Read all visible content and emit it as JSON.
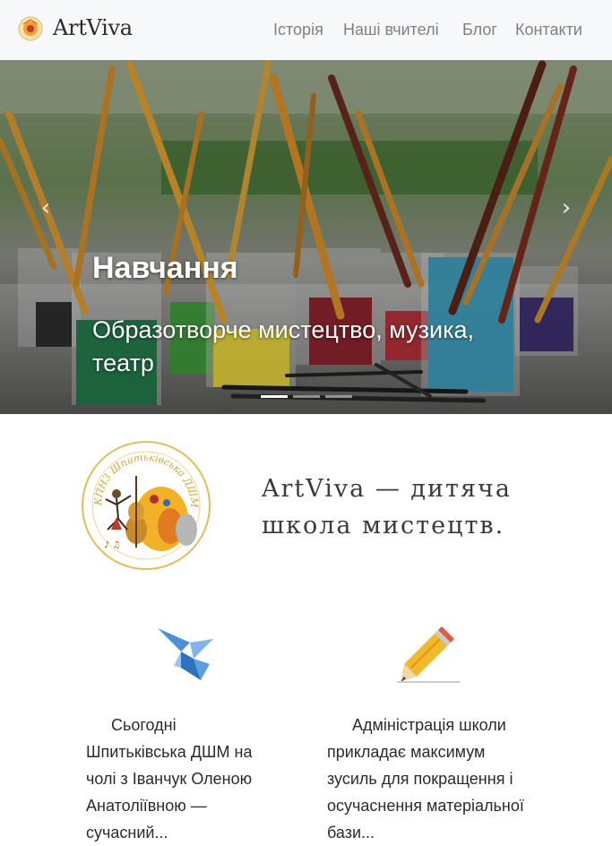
{
  "brand": {
    "name": "ArtViva",
    "logo_icon": "sun-flower-logo-icon"
  },
  "nav": {
    "items": [
      {
        "label": "Історія"
      },
      {
        "label": "Наші вчителі"
      },
      {
        "label": "Блог"
      },
      {
        "label": "Контакти"
      }
    ]
  },
  "carousel": {
    "slide_title": "Навчання",
    "slide_subtitle": "Образотворче мистецтво, музика, театр",
    "prev_icon": "chevron-left-icon",
    "next_icon": "chevron-right-icon",
    "slide_count": 3,
    "active_slide": 1
  },
  "about": {
    "logo_text": "КПНЗ Шпитьківська ДШМ",
    "tagline": "ArtViva — дитяча школа мистецтв."
  },
  "features": [
    {
      "icon": "origami-bird-icon",
      "text": "Сьогодні Шпитьківська ДШМ на чолі з Іванчук Оленою Анатоліївною — сучасний..."
    },
    {
      "icon": "pencil-icon",
      "text": "Адміністрація школи прикладає максимум зусиль для покращення і осучаснення матеріальної бази..."
    }
  ],
  "colors": {
    "navbar_bg": "#f7f8fa",
    "nav_link": "#808080",
    "text": "#2b2b2b"
  }
}
